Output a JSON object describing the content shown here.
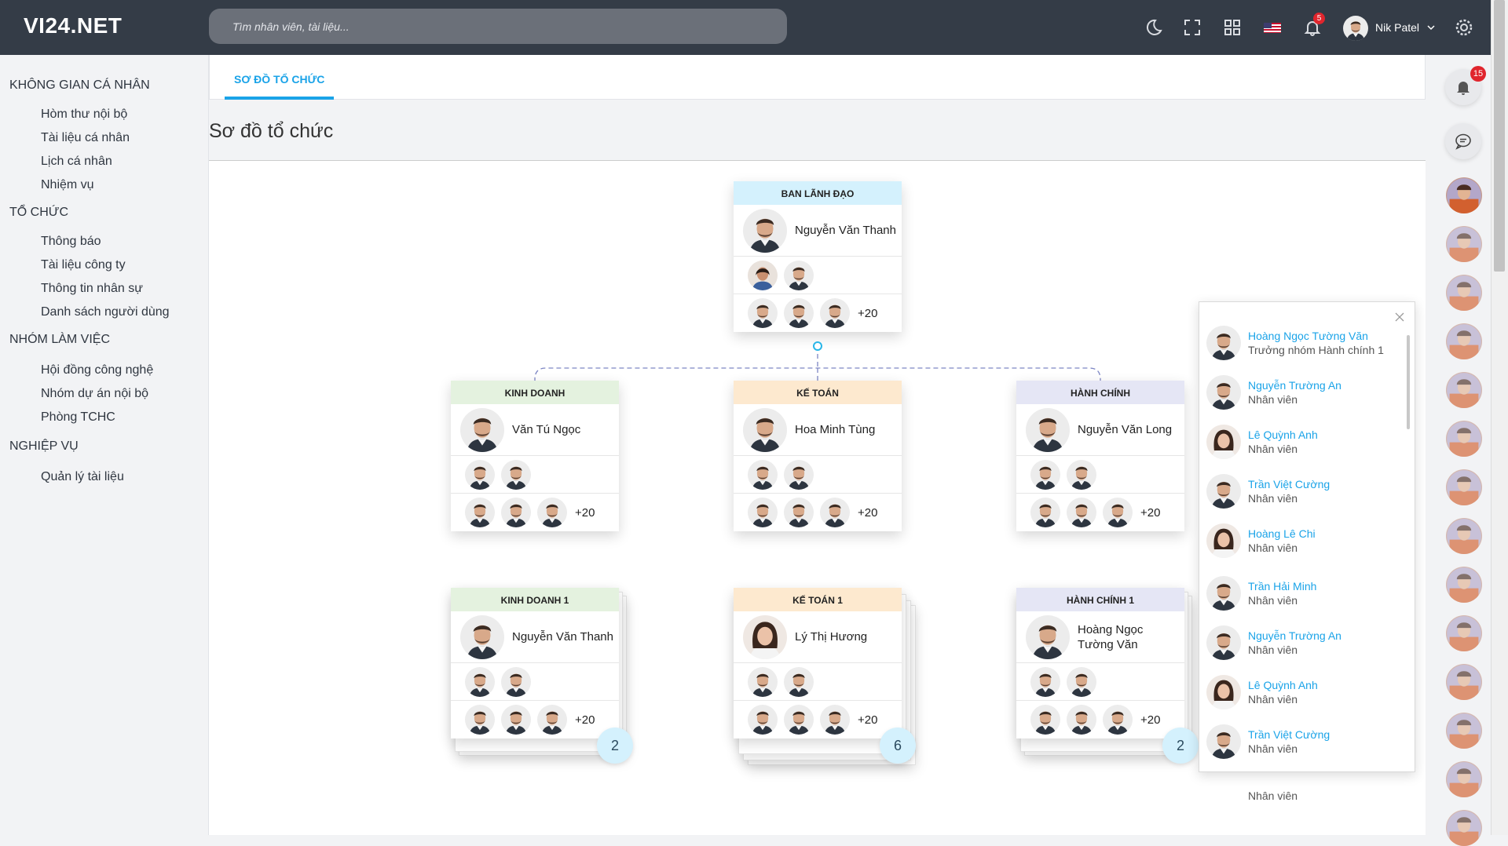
{
  "topbar": {
    "logo": "VI24.NET",
    "search_placeholder": "Tìm nhân viên, tài liệu...",
    "notification_count": "5",
    "user_name": "Nik Patel"
  },
  "sidebar": {
    "sections": [
      {
        "title": "KHÔNG GIAN CÁ NHÂN",
        "items": [
          "Hòm thư nội bộ",
          "Tài liệu cá nhân",
          "Lịch cá nhân",
          "Nhiệm vụ"
        ]
      },
      {
        "title": "TỔ CHỨC",
        "items": [
          "Thông báo",
          "Tài liệu công ty",
          "Thông tin nhân sự",
          "Danh sách người dùng"
        ]
      },
      {
        "title": "NHÓM LÀM VIỆC",
        "items": [
          "Hội đồng công nghệ",
          "Nhóm dự án nội bộ",
          "Phòng TCHC"
        ]
      },
      {
        "title": "NGHIỆP VỤ",
        "items": [
          "Quản lý tài liệu"
        ]
      }
    ]
  },
  "tabs": {
    "active": "SƠ ĐỒ TỔ CHỨC"
  },
  "page_title": "Sơ đồ tổ chức",
  "org": {
    "root": {
      "title": "BAN LÃNH ĐẠO",
      "leader": "Nguyễn Văn Thanh",
      "more": "+20",
      "head_color": "#d4f1fd"
    },
    "departments": [
      {
        "title": "KINH DOANH",
        "leader": "Văn Tú Ngọc",
        "more": "+20",
        "head_color": "#e4f2df",
        "dot_color": "#7cc36b"
      },
      {
        "title": "KẾ TOÁN",
        "leader": "Hoa Minh Tùng",
        "more": "+20",
        "head_color": "#fde9cf",
        "dot_color": "#f0a83a"
      },
      {
        "title": "HÀNH CHÍNH",
        "leader": "Nguyễn Văn Long",
        "more": "+20",
        "head_color": "#e5e6f5",
        "dot_color": "#8a90c9"
      }
    ],
    "sub_teams": [
      {
        "title": "KINH DOANH 1",
        "leader": "Nguyễn Văn Thanh",
        "more": "+20",
        "count": "2",
        "head_color": "#e4f2df"
      },
      {
        "title": "KẾ TOÁN 1",
        "leader": "Lý Thị Hương",
        "more": "+20",
        "count": "6",
        "head_color": "#fde9cf"
      },
      {
        "title": "HÀNH CHÍNH 1",
        "leader": "Hoàng Ngọc Tường Văn",
        "more": "+20",
        "count": "2",
        "head_color": "#e5e6f5"
      }
    ]
  },
  "popup": {
    "members": [
      {
        "name": "Hoàng Ngọc Tường Văn",
        "role": "Trưởng nhóm Hành chính 1"
      },
      {
        "name": "Nguyễn Trường An",
        "role": "Nhân viên"
      },
      {
        "name": "Lê Quỳnh Anh",
        "role": "Nhân viên"
      },
      {
        "name": "Trần Việt Cường",
        "role": "Nhân viên"
      },
      {
        "name": "Hoàng Lê Chi",
        "role": "Nhân viên"
      },
      {
        "name": "Trần Hải Minh",
        "role": "Nhân viên"
      },
      {
        "name": "Nguyễn Trường An",
        "role": "Nhân viên"
      },
      {
        "name": "Lê Quỳnh Anh",
        "role": "Nhân viên"
      },
      {
        "name": "Trần Việt Cường",
        "role": "Nhân viên"
      }
    ],
    "overflow_role": "Nhân viên"
  },
  "rail": {
    "notification_count": "15"
  },
  "colors": {
    "accent": "#1aa3e8",
    "topbar": "#343c47",
    "badge": "#e0252d"
  },
  "icons": [
    "moon-icon",
    "fullscreen-icon",
    "apps-grid-icon",
    "us-flag-icon",
    "bell-icon",
    "settings-gear-icon",
    "chat-icon",
    "close-icon",
    "chevron-down-icon"
  ]
}
